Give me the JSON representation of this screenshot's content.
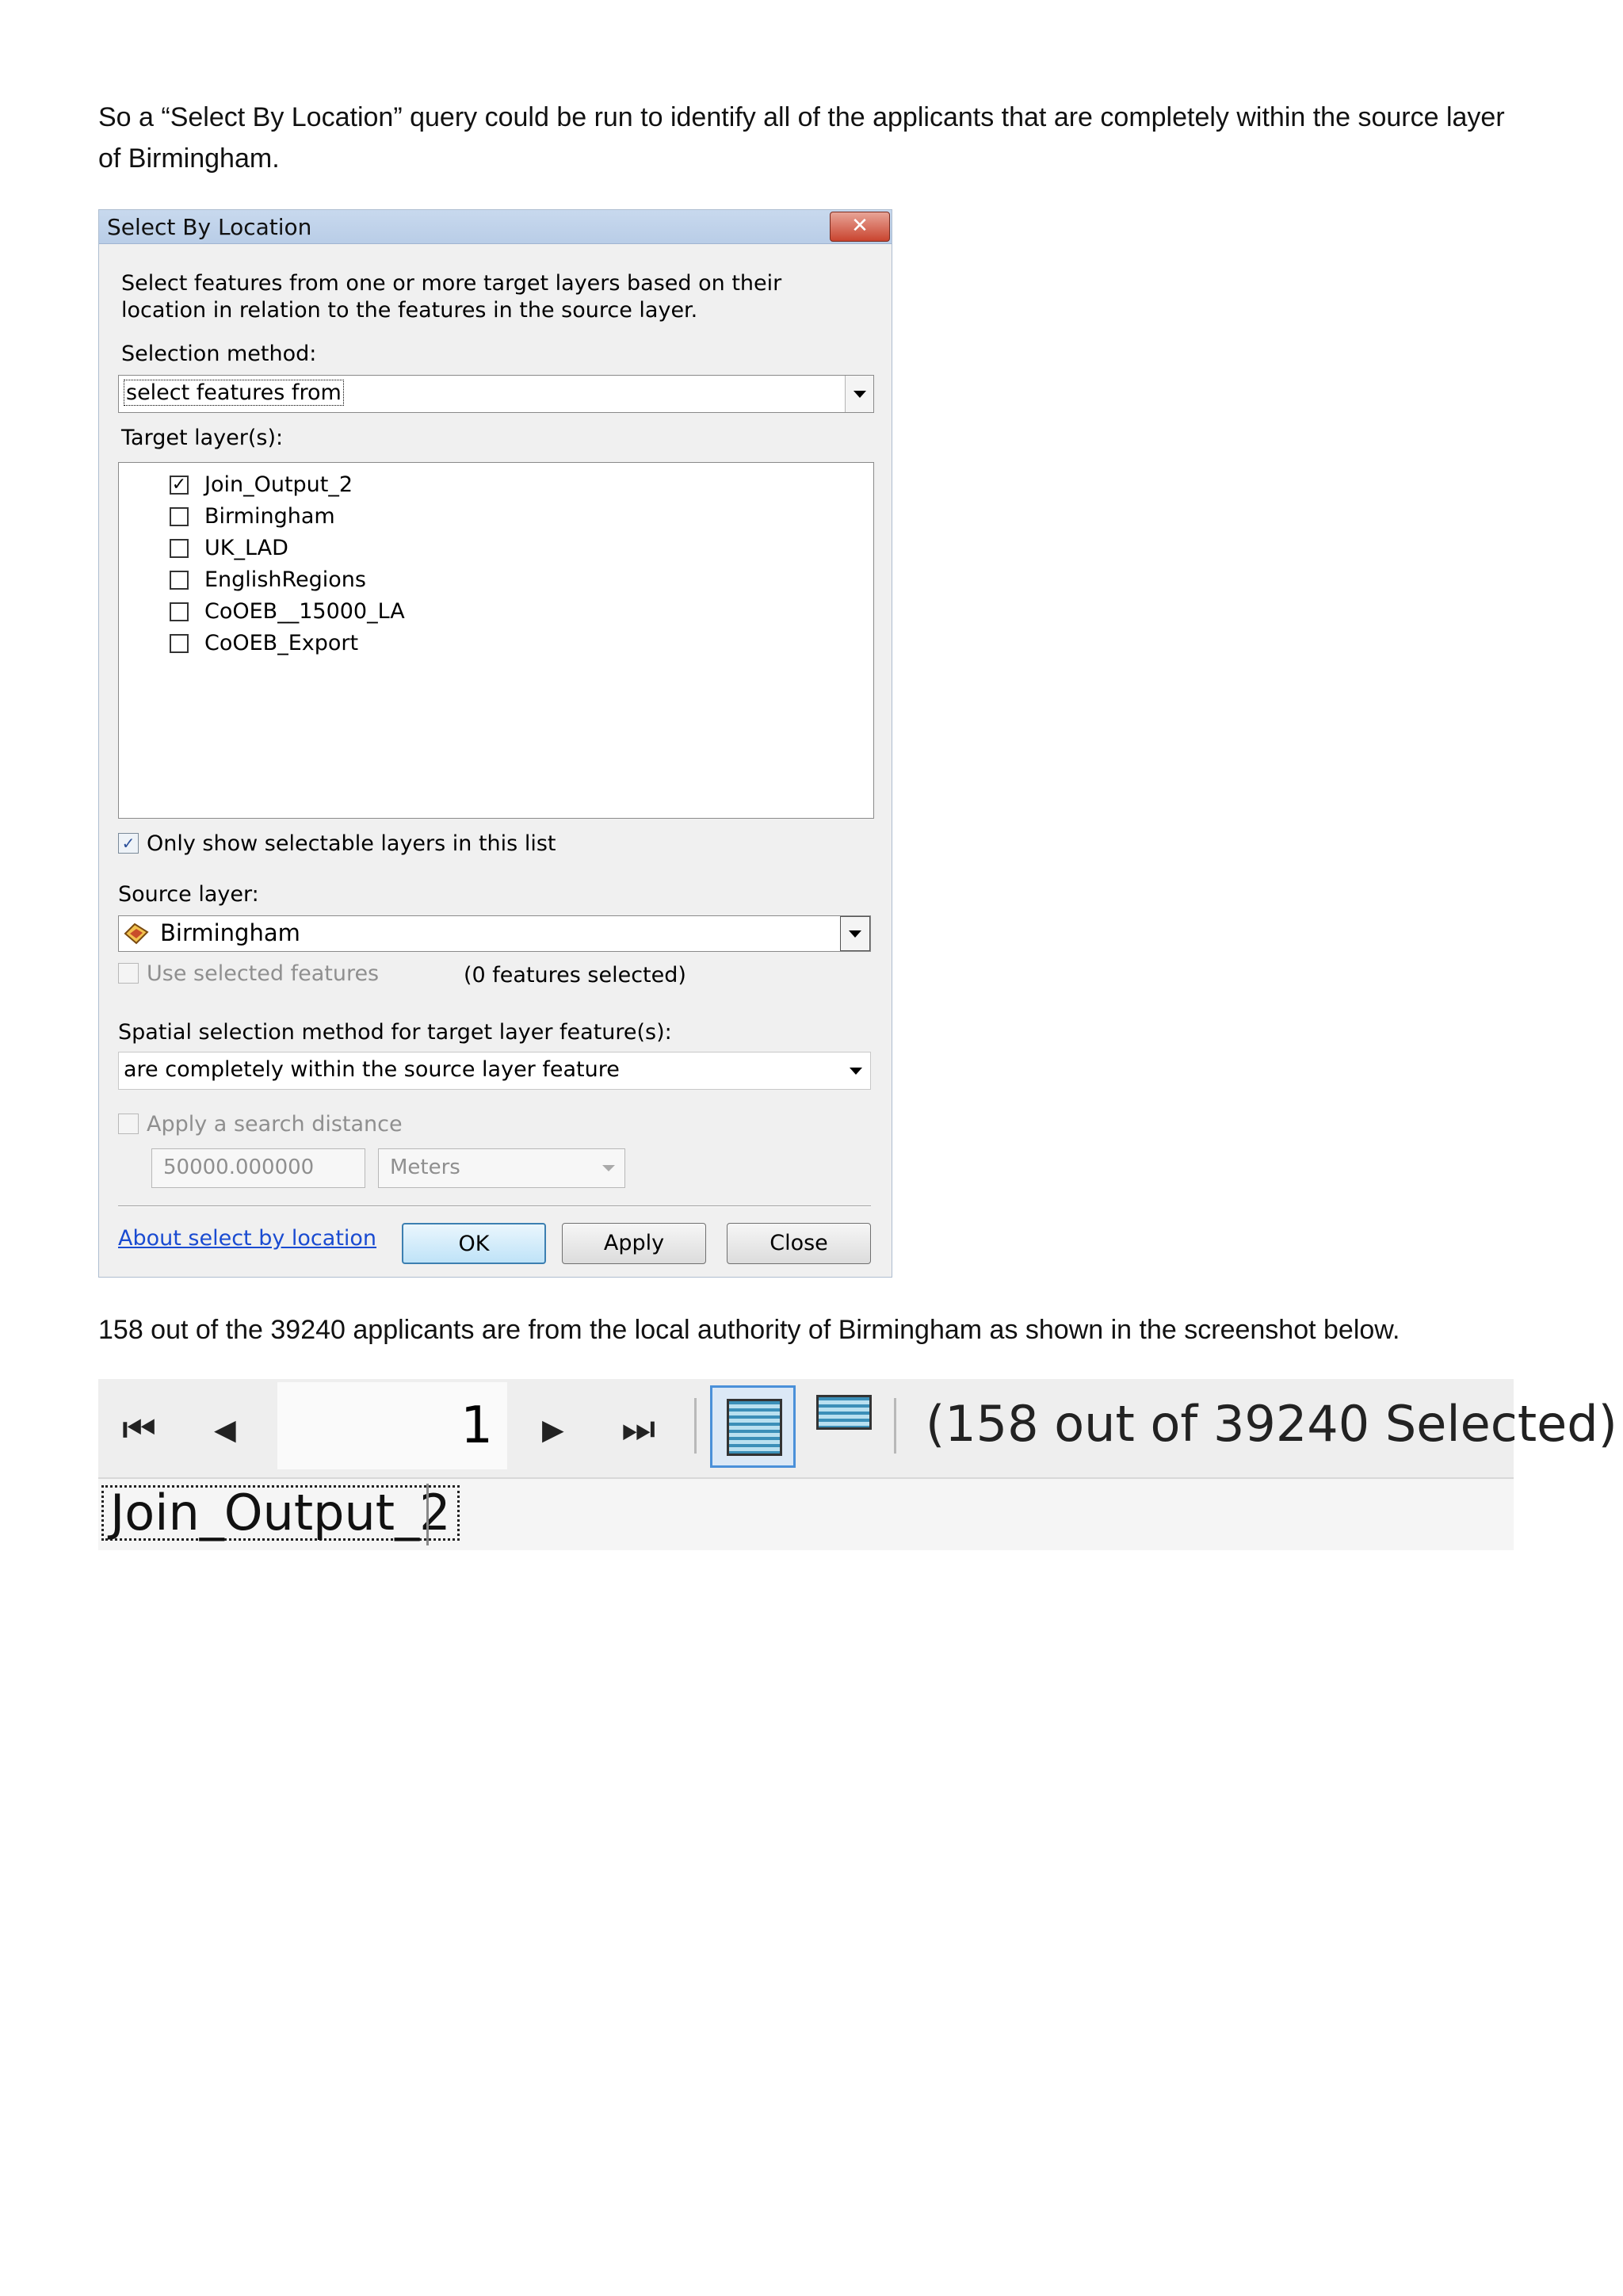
{
  "text": {
    "para1": "So a “Select By Location” query could be run to identify all of the applicants that are completely within the source layer of Birmingham.",
    "para2": "158 out of the 39240 applicants are from the local authority of Birmingham as shown in the screenshot below."
  },
  "dialog": {
    "title": "Select By Location",
    "close_glyph": "✕",
    "description": "Select features from one or more target layers based on their location in relation to the features in the source layer.",
    "selection_method_label": "Selection method:",
    "selection_method_value": "select features from",
    "target_layers_label": "Target layer(s):",
    "target_layers": [
      {
        "name": "Join_Output_2",
        "checked": true
      },
      {
        "name": "Birmingham",
        "checked": false
      },
      {
        "name": "UK_LAD",
        "checked": false
      },
      {
        "name": "EnglishRegions",
        "checked": false
      },
      {
        "name": "CoOEB__15000_LA",
        "checked": false
      },
      {
        "name": "CoOEB_Export",
        "checked": false
      }
    ],
    "only_selectable_label": "Only show selectable layers in this list",
    "only_selectable_checked": true,
    "source_layer_label": "Source layer:",
    "source_layer_value": "Birmingham",
    "use_selected_label": "Use selected features",
    "features_selected_text": "(0 features selected)",
    "spatial_method_label": "Spatial selection method for target layer feature(s):",
    "spatial_method_value": "are completely within the source layer feature",
    "search_distance_label": "Apply a search distance",
    "search_distance_value": "50000.000000",
    "units_value": "Meters",
    "about_link": "About select by location",
    "ok_label": "OK",
    "apply_label": "Apply",
    "close_label": "Close",
    "check_glyph": "✓"
  },
  "table_toolbar": {
    "record_number": "1",
    "selection_status": "(158 out of 39240 Selected)",
    "table_tab": "Join_Output_2",
    "first_glyph": "⏮",
    "prev_glyph": "◀",
    "next_glyph": "▶",
    "last_glyph": "⏭"
  },
  "colors": {
    "dialog_background": "#f0f0f0",
    "titlebar": "#b9cde7",
    "link": "#1a4bd1",
    "active_button": "#4a90d9"
  }
}
